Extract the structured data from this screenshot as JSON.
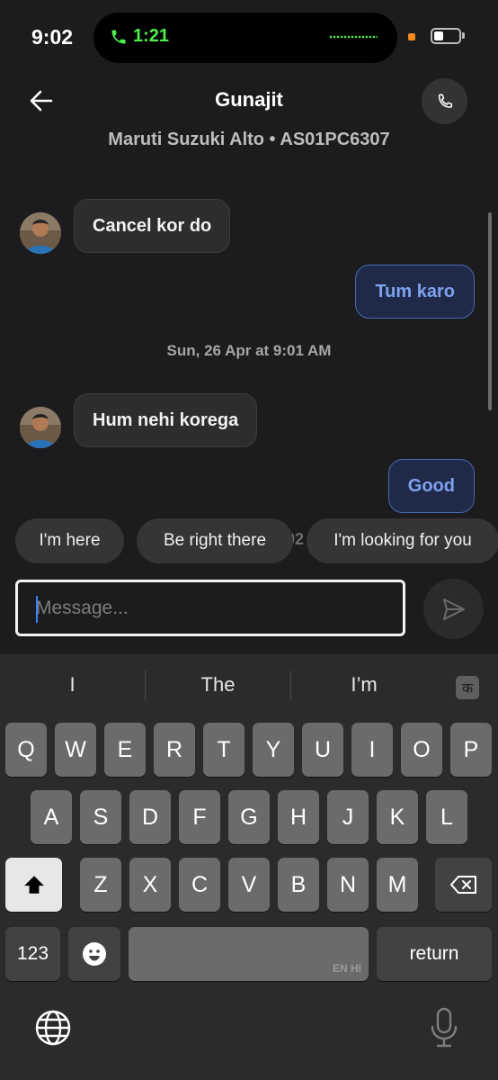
{
  "status_bar": {
    "time": "9:02",
    "call_duration": "1:21",
    "battery_level": 0.4
  },
  "header": {
    "contact_name": "Gunajit",
    "vehicle_info": "Maruti Suzuki Alto • AS01PC6307"
  },
  "messages": [
    {
      "direction": "incoming",
      "text": "Cancel kor do"
    },
    {
      "direction": "outgoing",
      "text": "Tum karo"
    },
    {
      "type": "date",
      "text": "Sun, 26 Apr at 9:01 AM"
    },
    {
      "direction": "incoming",
      "text": "Hum nehi korega"
    },
    {
      "direction": "outgoing",
      "text": "Good"
    }
  ],
  "quick_replies": [
    "I'm here",
    "Be right there",
    "I'm looking for you"
  ],
  "composer": {
    "placeholder": "Message..."
  },
  "keyboard": {
    "suggestions": [
      "I",
      "The",
      "I’m"
    ],
    "lang_key": "क",
    "row1": [
      "Q",
      "W",
      "E",
      "R",
      "T",
      "Y",
      "U",
      "I",
      "O",
      "P"
    ],
    "row2": [
      "A",
      "S",
      "D",
      "F",
      "G",
      "H",
      "J",
      "K",
      "L"
    ],
    "row3": [
      "Z",
      "X",
      "C",
      "V",
      "B",
      "N",
      "M"
    ],
    "numbers_key": "123",
    "return_key": "return",
    "space_lang": "EN HI"
  },
  "colors": {
    "background": "#1c1c1e",
    "incoming_bubble": "#2d2d2f",
    "outgoing_bubble": "#1e2a48",
    "outgoing_text": "#7fa2f0",
    "call_green": "#4ef04a"
  }
}
